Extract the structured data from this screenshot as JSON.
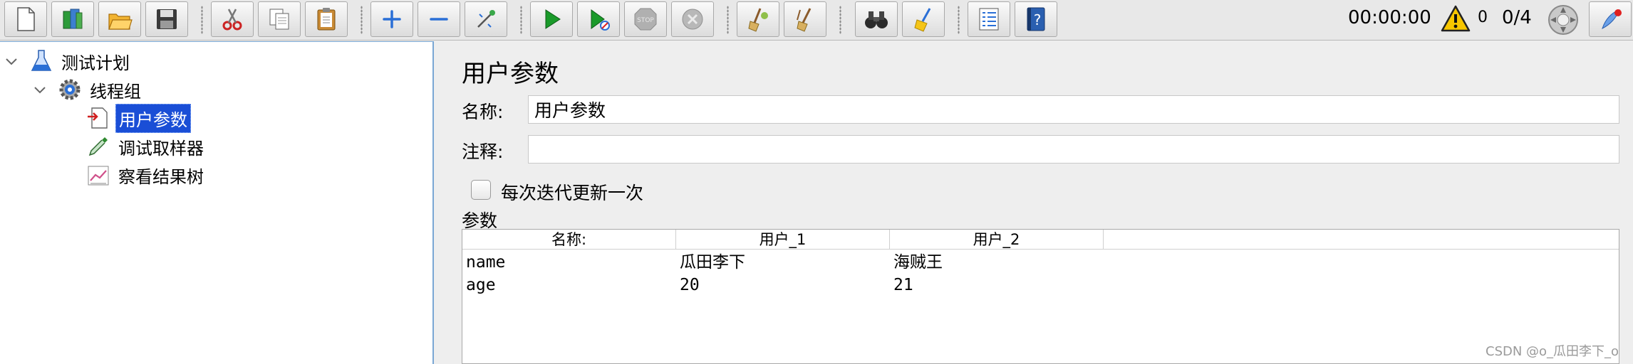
{
  "toolbar": {
    "timer": "00:00:00",
    "warning_count": "0",
    "thread_count": "0/4",
    "buttons": [
      "new",
      "templates",
      "open",
      "save",
      "cut",
      "copy",
      "paste",
      "expand",
      "collapse",
      "toggle",
      "start",
      "start-no-pause",
      "stop",
      "shutdown",
      "clear",
      "clear-all",
      "search",
      "reset-search",
      "function-helper",
      "help"
    ]
  },
  "tree": {
    "nodes": [
      {
        "label": "测试计划",
        "icon": "flask-icon"
      },
      {
        "label": "线程组",
        "icon": "gear-icon"
      },
      {
        "label": "用户参数",
        "icon": "user-params-icon"
      },
      {
        "label": "调试取样器",
        "icon": "pipette-icon"
      },
      {
        "label": "察看结果树",
        "icon": "chart-icon"
      }
    ]
  },
  "panel": {
    "title": "用户参数",
    "name_label": "名称:",
    "name_value": "用户参数",
    "comment_label": "注释:",
    "comment_value": "",
    "checkbox_label": "每次迭代更新一次",
    "checkbox_checked": false,
    "params_label": "参数"
  },
  "table": {
    "headers": [
      "名称:",
      "用户_1",
      "用户_2"
    ],
    "rows": [
      [
        "name",
        "瓜田李下",
        "海贼王"
      ],
      [
        "age",
        "20",
        "21"
      ]
    ]
  },
  "watermark": "CSDN @o_瓜田李下_o",
  "colors": {
    "selection": "#1a4ed6",
    "tree_border": "#7aa7d4",
    "start_green": "#1a9a2a"
  }
}
